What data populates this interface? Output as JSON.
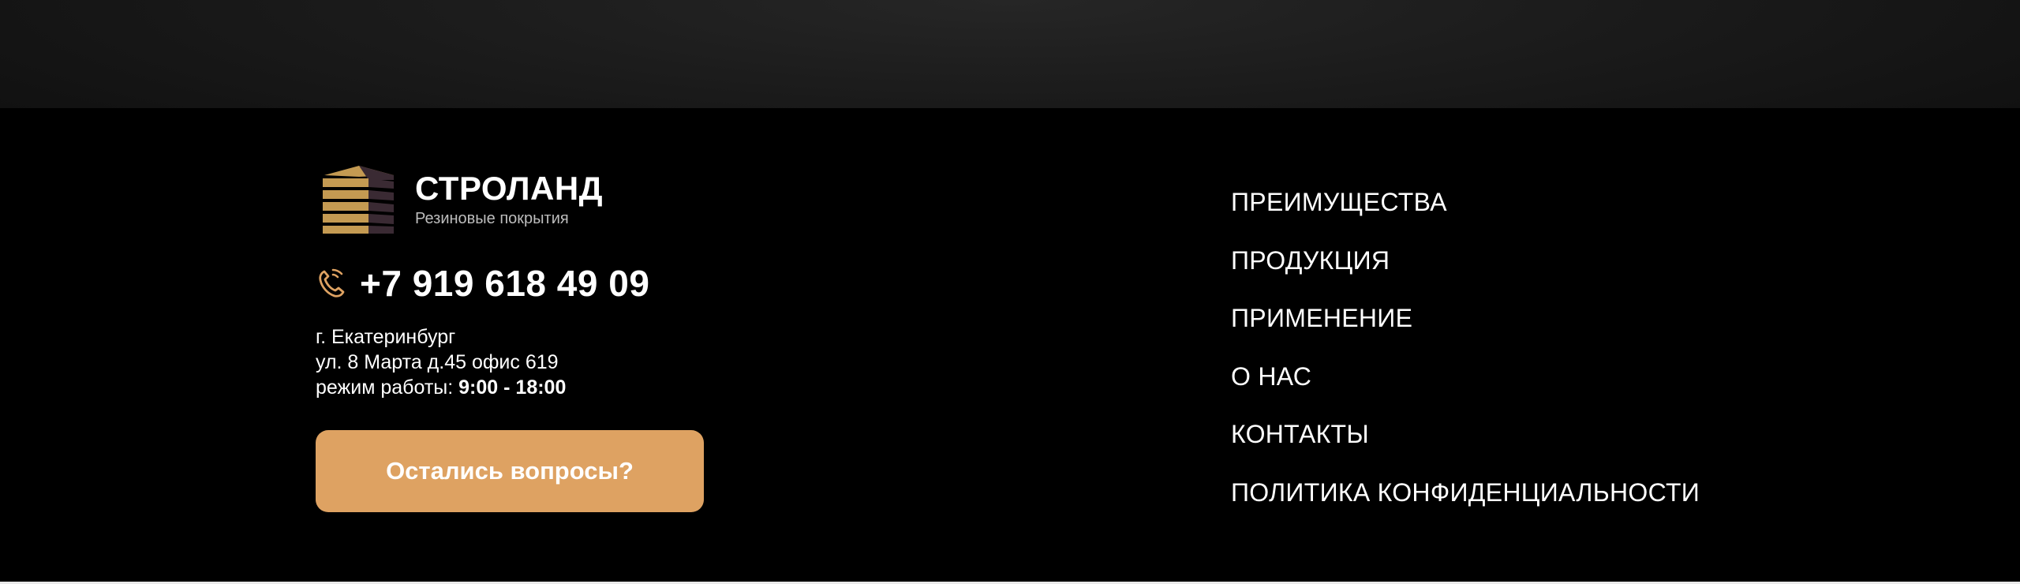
{
  "brand": {
    "name": "СТРОЛАНД",
    "tagline": "Резиновые покрытия",
    "logo_icon": "stacked-tiles-logo-icon",
    "colors": {
      "accent": "#dea262",
      "logo_gold": "#c49a52",
      "logo_dark": "#3a2a33"
    }
  },
  "contact": {
    "phone_icon": "phone-icon",
    "phone": "+7 919 618 49 09",
    "city": "г. Екатеринбург",
    "street": "ул. 8 Марта д.45 офис 619",
    "hours_label": "режим работы:",
    "hours_value": "9:00 - 18:00"
  },
  "cta": {
    "label": "Остались вопросы?"
  },
  "nav": {
    "items": [
      {
        "label": "ПРЕИМУЩЕСТВА"
      },
      {
        "label": "ПРОДУКЦИЯ"
      },
      {
        "label": "ПРИМЕНЕНИЕ"
      },
      {
        "label": "О НАС"
      },
      {
        "label": "КОНТАКТЫ"
      },
      {
        "label": "ПОЛИТИКА КОНФИДЕНЦИАЛЬНОСТИ"
      }
    ]
  }
}
